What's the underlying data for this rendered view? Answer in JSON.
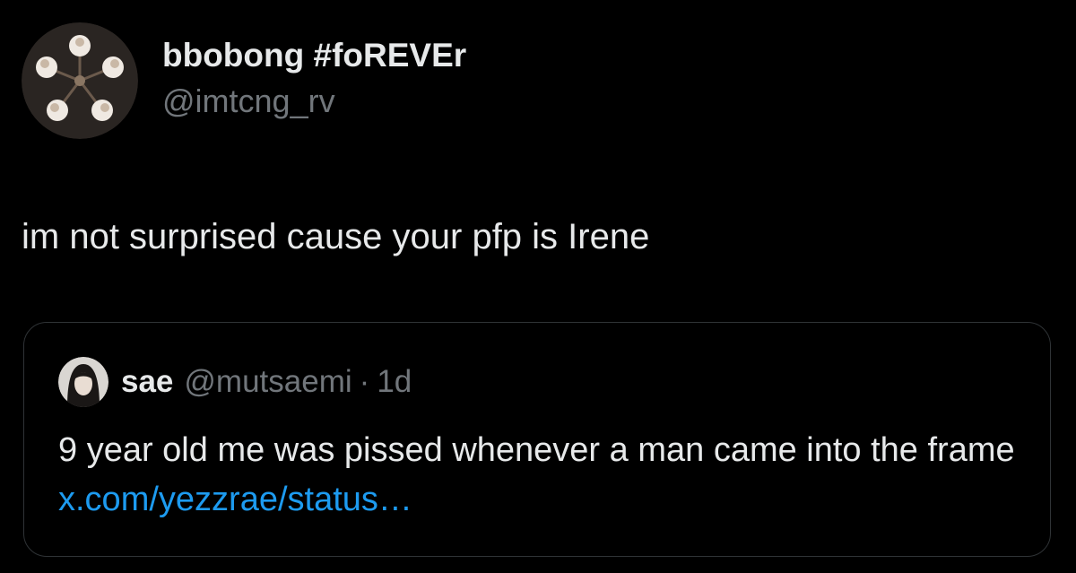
{
  "tweet": {
    "author": {
      "display_name": "bbobong #foREVEr",
      "handle": "@imtcng_rv",
      "avatar_icon": "avatar-image"
    },
    "text": "im not surprised cause your pfp is Irene",
    "quote": {
      "author_name": "sae",
      "author_handle": "@mutsaemi",
      "separator": "·",
      "time": "1d",
      "text": "9 year old me was pissed whenever a man came into the frame",
      "link": "x.com/yezzrae/status…",
      "avatar_icon": "avatar-image"
    }
  },
  "colors": {
    "background": "#000000",
    "text_primary": "#e7e9ea",
    "text_secondary": "#71767b",
    "link": "#1d9bf0",
    "border": "#2f3336"
  }
}
